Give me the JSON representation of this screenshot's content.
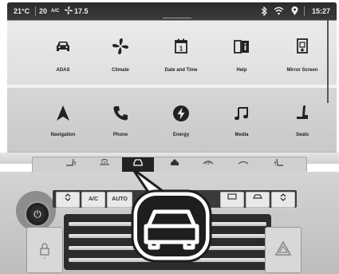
{
  "status_bar": {
    "temp_left": "21°C",
    "temp_mid": "20",
    "ac_label": "A/C",
    "fan_value": "17.5",
    "time": "15:27",
    "icons": [
      "fan-icon",
      "bluetooth-icon",
      "wifi-icon",
      "location-pin-icon"
    ]
  },
  "apps": [
    {
      "label": "ADAS",
      "icon": "car-icon"
    },
    {
      "label": "Climate",
      "icon": "fan-icon"
    },
    {
      "label": "Date and Time",
      "icon": "calendar-icon"
    },
    {
      "label": "Help",
      "icon": "help-book-icon"
    },
    {
      "label": "Mirror Screen",
      "icon": "mirror-screen-icon"
    },
    {
      "label": "Navigation",
      "icon": "navigation-arrow-icon"
    },
    {
      "label": "Phone",
      "icon": "phone-icon"
    },
    {
      "label": "Energy",
      "icon": "energy-icon"
    },
    {
      "label": "Media",
      "icon": "music-note-icon"
    },
    {
      "label": "Seats",
      "icon": "seat-icon"
    }
  ],
  "climate_bar": {
    "ac_label": "A/C",
    "auto_label": "AUTO"
  },
  "highlight_color": "#1e1e1e"
}
